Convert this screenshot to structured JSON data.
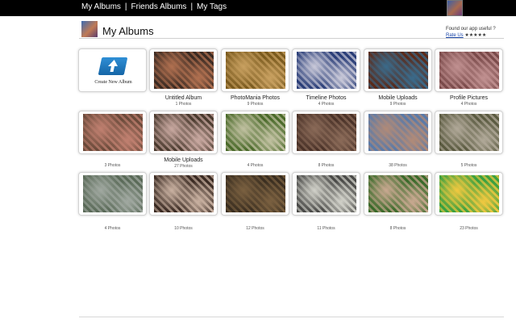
{
  "topbar": {
    "nav": [
      {
        "label": "My Albums"
      },
      {
        "label": "Friends Albums"
      },
      {
        "label": "My Tags"
      }
    ],
    "separator": "|"
  },
  "header": {
    "title": "My Albums",
    "promo_text": "Found our app useful ?",
    "rate_label": "Rate Us",
    "stars": "★★★★★"
  },
  "create_album": {
    "label": "Create New Album"
  },
  "albums": [
    {
      "name": "Untitled Album",
      "count": "1 Photos",
      "colors": [
        "#3a2a22",
        "#b07050"
      ]
    },
    {
      "name": "PhotoMania Photos",
      "count": "9 Photos",
      "colors": [
        "#7a5a1e",
        "#c8a060"
      ]
    },
    {
      "name": "Timeline Photos",
      "count": "4 Photos",
      "colors": [
        "#2a3e78",
        "#c8c8d8"
      ]
    },
    {
      "name": "Mobile Uploads",
      "count": "9 Photos",
      "colors": [
        "#5a2a1a",
        "#3a6a8a"
      ]
    },
    {
      "name": "Profile Pictures",
      "count": "4 Photos",
      "colors": [
        "#7a4a4a",
        "#c09090"
      ]
    },
    {
      "name": "",
      "count": "3 Photos",
      "colors": [
        "#6a4a3a",
        "#c08070"
      ]
    },
    {
      "name": "Mobile Uploads",
      "count": "27 Photos",
      "colors": [
        "#4a3a2e",
        "#c8a8a0"
      ]
    },
    {
      "name": "",
      "count": "4 Photos",
      "colors": [
        "#4a6a2a",
        "#c0c0a0"
      ]
    },
    {
      "name": "",
      "count": "8 Photos",
      "colors": [
        "#4a3228",
        "#8a6a58"
      ]
    },
    {
      "name": "",
      "count": "38 Photos",
      "colors": [
        "#5a7aa8",
        "#b08a78"
      ]
    },
    {
      "name": "",
      "count": "5 Photos",
      "colors": [
        "#5a5a40",
        "#b0a898"
      ]
    },
    {
      "name": "",
      "count": "4 Photos",
      "colors": [
        "#5a6a58",
        "#a0a8a0"
      ]
    },
    {
      "name": "",
      "count": "10 Photos",
      "colors": [
        "#3a2a22",
        "#c8b0a0"
      ]
    },
    {
      "name": "",
      "count": "12 Photos",
      "colors": [
        "#3a2e20",
        "#7a6040"
      ]
    },
    {
      "name": "",
      "count": "11 Photos",
      "colors": [
        "#4a4a48",
        "#d0d0c8"
      ]
    },
    {
      "name": "",
      "count": "8 Photos",
      "colors": [
        "#3a6a2a",
        "#c8a890"
      ]
    },
    {
      "name": "",
      "count": "23 Photos",
      "colors": [
        "#3aa040",
        "#f0c840"
      ]
    }
  ]
}
